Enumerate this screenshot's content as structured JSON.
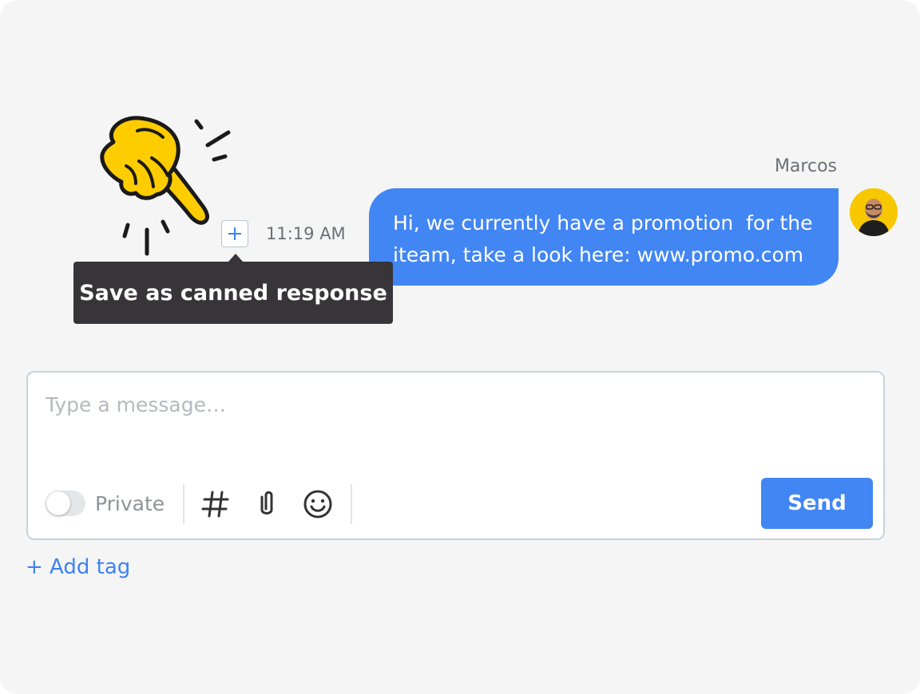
{
  "message": {
    "sender": "Marcos",
    "lines": [
      "Hi, we currently have a promotion  for the",
      "iteam, take a look here: www.promo.com"
    ],
    "time": "11:19 AM",
    "avatar_icon": "person-avatar"
  },
  "tooltip": {
    "text": "Save as canned response"
  },
  "composer": {
    "placeholder": "Type a message…",
    "private_label": "Private",
    "private_enabled": false,
    "send_label": "Send"
  },
  "add_tag_label": "+ Add tag",
  "colors": {
    "accent": "#4286f4",
    "tooltip_bg": "#37343a",
    "hand_yellow": "#ffcc00",
    "background": "#f5f5f5"
  },
  "icons": [
    "pointing-hand-illustration",
    "plus-icon",
    "hashtag-icon",
    "paperclip-icon",
    "smiley-icon"
  ]
}
